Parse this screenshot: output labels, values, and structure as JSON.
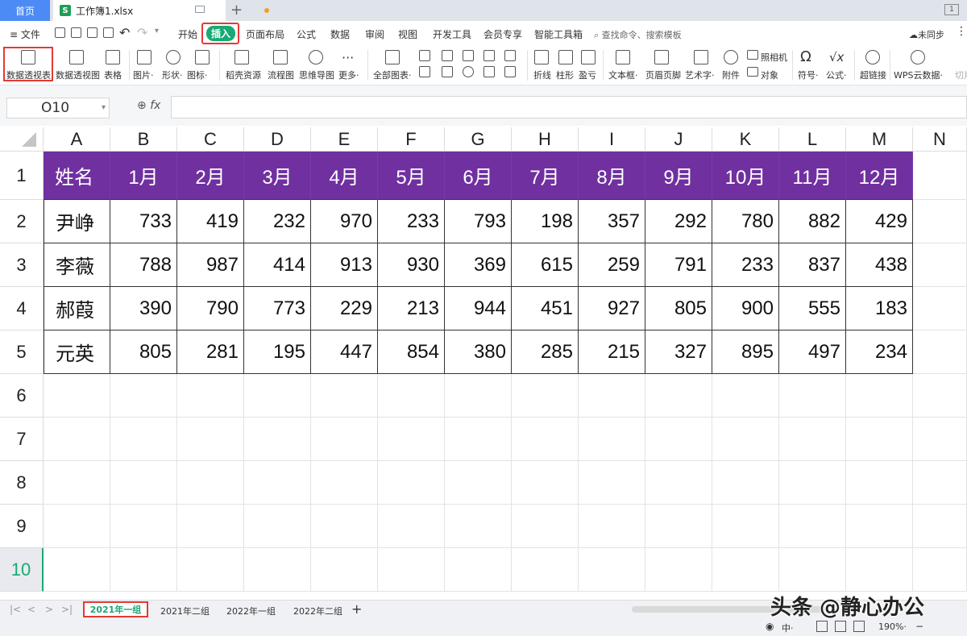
{
  "titlebar": {
    "home_tab": "首页",
    "file_tab": "工作簿1.xlsx",
    "file_icon_letter": "S",
    "window_button": "1"
  },
  "menubar": {
    "file_menu": "≡ 文件",
    "tabs": [
      "开始",
      "插入",
      "页面布局",
      "公式",
      "数据",
      "审阅",
      "视图",
      "开发工具",
      "会员专享",
      "智能工具箱"
    ],
    "active_tab": "插入",
    "search_placeholder": "查找命令、搜索模板",
    "sync_label": "未同步"
  },
  "ribbon": {
    "items": [
      "数据透视表",
      "数据透视图",
      "表格",
      "图片·",
      "形状·",
      "图标·",
      "稻壳资源",
      "流程图",
      "思维导图",
      "更多·",
      "全部图表·",
      "折线",
      "柱形",
      "盈亏",
      "文本框·",
      "页眉页脚",
      "艺术字·",
      "附件",
      "对象",
      "符号·",
      "公式·",
      "超链接",
      "WPS云数据·",
      "切片"
    ],
    "camera_label": "照相机"
  },
  "formula_bar": {
    "name_box": "O10",
    "fx_label": "fx",
    "formula": ""
  },
  "grid": {
    "columns": [
      "A",
      "B",
      "C",
      "D",
      "E",
      "F",
      "G",
      "H",
      "I",
      "J",
      "K",
      "L",
      "M",
      "N"
    ],
    "rows": [
      "1",
      "2",
      "3",
      "4",
      "5",
      "6",
      "7",
      "8",
      "9",
      "10"
    ],
    "selected_row": "10",
    "header_row": [
      "姓名",
      "1月",
      "2月",
      "3月",
      "4月",
      "5月",
      "6月",
      "7月",
      "8月",
      "9月",
      "10月",
      "11月",
      "12月"
    ],
    "data_rows": [
      [
        "尹峥",
        "733",
        "419",
        "232",
        "970",
        "233",
        "793",
        "198",
        "357",
        "292",
        "780",
        "882",
        "429"
      ],
      [
        "李薇",
        "788",
        "987",
        "414",
        "913",
        "930",
        "369",
        "615",
        "259",
        "791",
        "233",
        "837",
        "438"
      ],
      [
        "郝葭",
        "390",
        "790",
        "773",
        "229",
        "213",
        "944",
        "451",
        "927",
        "805",
        "900",
        "555",
        "183"
      ],
      [
        "元英",
        "805",
        "281",
        "195",
        "447",
        "854",
        "380",
        "285",
        "215",
        "327",
        "895",
        "497",
        "234"
      ]
    ],
    "header_color": "#7030a0"
  },
  "sheets": {
    "tabs": [
      "2021年一组",
      "2021年二组",
      "2022年一组",
      "2022年二组"
    ],
    "active": "2021年一组",
    "add_label": "+"
  },
  "statusbar": {
    "ime": "中·",
    "zoom": "190%·"
  },
  "watermark": "头条 @静心办公",
  "colors": {
    "accent": "#19a974",
    "highlight_box": "#e53935",
    "home_tab": "#4c8bf5"
  }
}
